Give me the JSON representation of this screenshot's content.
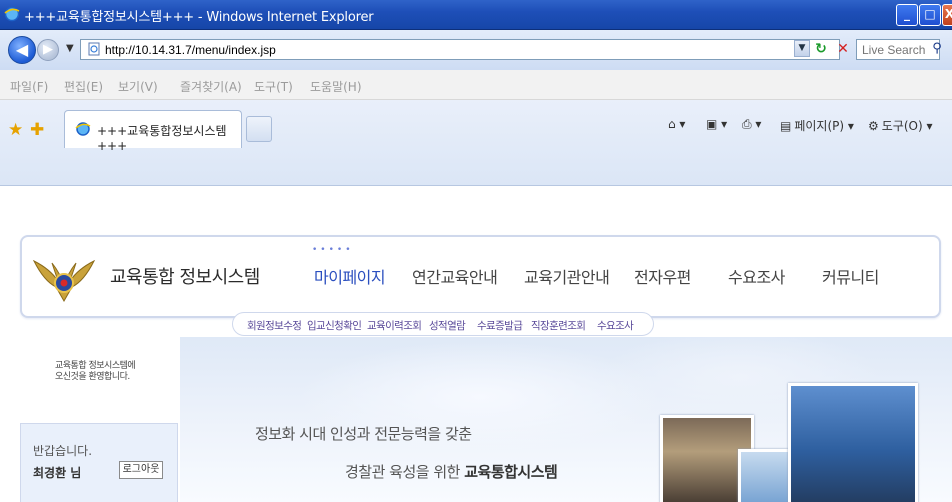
{
  "window": {
    "title": "+++교육통합정보시스템+++ - Windows Internet Explorer",
    "buttons": {
      "minimize": "_",
      "maximize": "□",
      "close": "X"
    }
  },
  "address_bar": {
    "url": "http://10.14.31.7/menu/index.jsp",
    "search_placeholder": "Live Search"
  },
  "menu_bar": {
    "items": [
      "파일(F)",
      "편집(E)",
      "보기(V)",
      "즐겨찾기(A)",
      "도구(T)",
      "도움말(H)"
    ]
  },
  "tab_bar": {
    "tab_title": "+++교육통합정보시스템+++",
    "commands": {
      "page": "페이지(P)",
      "tools": "도구(O)"
    }
  },
  "site": {
    "name": "교육통합 정보시스템",
    "gnb": [
      "마이페이지",
      "연간교육안내",
      "교육기관안내",
      "전자우편",
      "수요조사",
      "커뮤니티"
    ],
    "sub_nav": [
      "회원정보수정",
      "입교신청확인",
      "교육이력조회",
      "성적열람",
      "수료증발급",
      "직장훈련조회",
      "수요조사"
    ],
    "welcome_line1": "교육통합 정보시스템에",
    "welcome_line2": "오신것을 환영합니다.",
    "greeting": "반갑습니다.",
    "user": "최경환 님",
    "logout": "로그아웃",
    "slogan_line1": "정보화 시대 인성과 전문능력을 갖춘",
    "slogan_line2_prefix": "경찰관 육성을 위한",
    "slogan_line2_emphasis": "교육통합시스템"
  }
}
